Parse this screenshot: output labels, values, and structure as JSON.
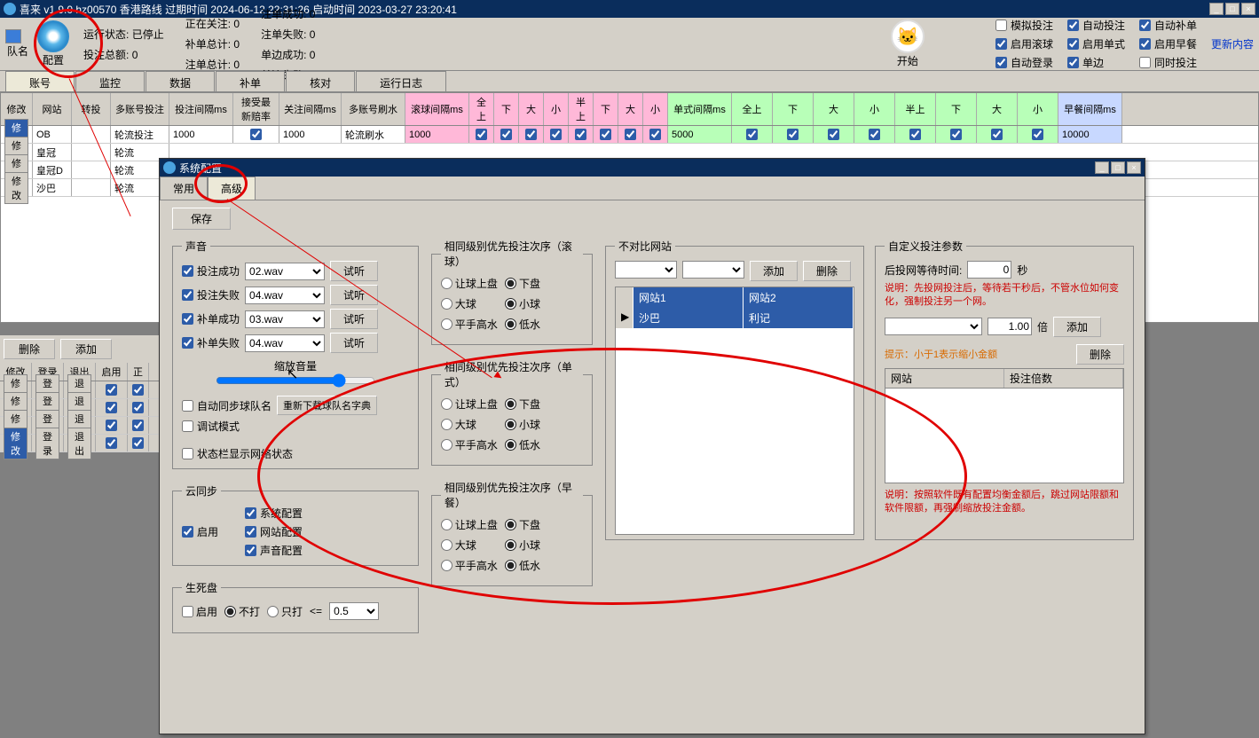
{
  "titlebar": {
    "text": "喜来 v1.9.0 hz00570 香港路线 过期时间 2024-06-12 22:31:26 启动时间 2023-03-27 23:20:41"
  },
  "top": {
    "team_label": "队名",
    "config_label": "配置",
    "run_state_label": "运行状态:",
    "run_state_value": "已停止",
    "bet_total_label": "投注总额:",
    "bet_total_value": "0",
    "watching_label": "正在关注:",
    "watching_value": "0",
    "fill_total_label": "补单总计:",
    "fill_total_value": "0",
    "bet_count_label": "注单总计:",
    "bet_count_value": "0",
    "inj_success": "注单成功:",
    "inj_fail": "注单失败:",
    "side_success": "单边成功:",
    "side_fail": "单边失败:",
    "zero": "0",
    "start_label": "开始"
  },
  "checks": {
    "simulate": "模拟投注",
    "auto_bet": "自动投注",
    "auto_fill": "自动补单",
    "enable_roll": "启用滚球",
    "enable_single": "启用单式",
    "enable_early": "启用早餐",
    "update_content": "更新内容",
    "auto_login": "自动登录",
    "single_side": "单边",
    "same_time": "同时投注"
  },
  "tabs": {
    "account": "账号",
    "monitor": "监控",
    "data": "数据",
    "fill": "补单",
    "check": "核对",
    "log": "运行日志"
  },
  "grid_headers": {
    "modify": "修改",
    "site": "网站",
    "forward": "转投",
    "multi_acc": "多账号投注",
    "bet_interval": "投注间隔ms",
    "accept_odds": "接受最新赔率",
    "watch_interval": "关注间隔ms",
    "multi_brush": "多账号刷水",
    "roll_interval": "滚球间隔ms",
    "full": "全上",
    "down": "下",
    "big": "大",
    "small": "小",
    "half_up": "半上",
    "single_interval": "单式间隔ms",
    "early_interval": "早餐间隔ms"
  },
  "grid_rows": [
    {
      "site": "OB",
      "multi": "轮流投注",
      "bi": "1000",
      "wi": "1000",
      "brush": "轮流刷水",
      "ri": "1000",
      "si": "5000",
      "ei": "10000",
      "active": true
    },
    {
      "site": "皇冠",
      "multi": "轮流"
    },
    {
      "site": "皇冠D",
      "multi": "轮流"
    },
    {
      "site": "沙巴",
      "multi": "轮流"
    }
  ],
  "second_grid": {
    "delete": "删除",
    "add": "添加",
    "modify": "修改",
    "login": "登录",
    "exit": "退出",
    "enable": "启用",
    "comp": "正"
  },
  "modal": {
    "title": "系统配置",
    "tab_normal": "常用",
    "tab_adv": "高级",
    "save": "保存",
    "sound_legend": "声音",
    "bet_success": "投注成功",
    "bet_fail": "投注失败",
    "fill_success": "补单成功",
    "fill_fail": "补单失败",
    "wav02": "02.wav",
    "wav03": "03.wav",
    "wav04": "04.wav",
    "try": "试听",
    "zoom_vol": "缩放音量",
    "auto_sync": "自动同步球队名",
    "redownload": "重新下载球队名字典",
    "debug_mode": "调试模式",
    "status_bar": "状态栏显示网络状态",
    "cloud_legend": "云同步",
    "enable": "启用",
    "sys_config": "系统配置",
    "site_config": "网站配置",
    "sound_config": "声音配置",
    "life_legend": "生死盘",
    "no_hit": "不打",
    "only_hit": "只打",
    "lte": "<=",
    "val05": "0.5",
    "priority_roll": "相同级别优先投注次序（滚球）",
    "priority_single": "相同级别优先投注次序（单式）",
    "priority_early": "相同级别优先投注次序（早餐）",
    "handicap_up": "让球上盘",
    "handicap_down": "下盘",
    "big_ball": "大球",
    "small_ball": "小球",
    "flat_high": "平手高水",
    "low_water": "低水",
    "no_compare": "不对比网站",
    "add": "添加",
    "delete": "删除",
    "site1": "网站1",
    "site2": "网站2",
    "shaba": "沙巴",
    "liji": "利记",
    "custom_params": "自定义投注参数",
    "post_wait": "后投网等待时间:",
    "seconds": "秒",
    "note1": "说明：先投网投注后，等待若干秒后，不管水位如何变化，强制投注另一个网。",
    "multiplier": "倍",
    "tip": "提示：小于1表示缩小金额",
    "site_col": "网站",
    "mult_col": "投注倍数",
    "note2": "说明：按照软件既有配置均衡金额后，跳过网站限额和软件限额，再强制缩放投注金额。",
    "wait_val": "0",
    "mult_val": "1.00"
  }
}
